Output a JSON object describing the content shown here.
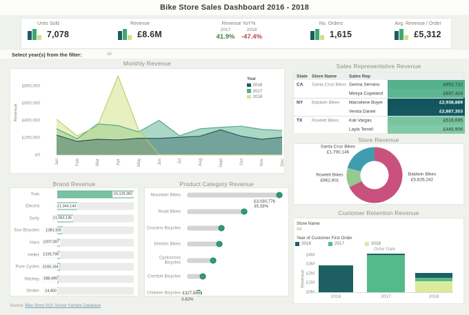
{
  "header": {
    "title": "Bike Store Sales Dashboard 2016 - 2018"
  },
  "kpis": {
    "units_sold": {
      "label": "Units Sold",
      "value": "7,078"
    },
    "revenue": {
      "label": "Revenue",
      "value": "£8.6M"
    },
    "yoy": {
      "label": "Revenue YoY%",
      "items": [
        {
          "year": "2017",
          "value": "41.9%",
          "color": "#3c7f45"
        },
        {
          "year": "2018",
          "value": "-47.4%",
          "color": "#bf4147"
        }
      ]
    },
    "orders": {
      "label": "No. Orders",
      "value": "1,615"
    },
    "avg_revenue": {
      "label": "Avg. Revenue / Order",
      "value": "£5,312"
    }
  },
  "filter": {
    "label": "Select year(s) from the filter:",
    "value": "All"
  },
  "palette": {
    "y2016": "#1d5c61",
    "y2017": "#4fb086",
    "y2018": "#d6e494",
    "kpi_bar_2016": "#1d5c61",
    "kpi_bar_2017": "#3fa86e",
    "kpi_bar_2018": "#cde08e"
  },
  "source": {
    "prefix": "Source: ",
    "link": "Bike Store SQL Server Sample Database"
  },
  "chart_data": [
    {
      "id": "monthly_revenue",
      "type": "area",
      "title": "Monthly Revenue",
      "xlabel": "",
      "ylabel": "Revenue",
      "x": [
        "Jan",
        "Feb",
        "Mar",
        "Apr",
        "May",
        "Jun",
        "Jul",
        "Aug",
        "Sept",
        "Oct",
        "Nov",
        "Dec"
      ],
      "yticks": [
        {
          "value": 0,
          "label": "£0"
        },
        {
          "value": 200000,
          "label": "£200,000"
        },
        {
          "value": 400000,
          "label": "£400,000"
        },
        {
          "value": 600000,
          "label": "£600,000"
        },
        {
          "value": 800000,
          "label": "£800,000"
        }
      ],
      "ylim": [
        0,
        1000000
      ],
      "legend_title": "Year",
      "legend_position": "top-right",
      "grid": false,
      "series": [
        {
          "name": "2016",
          "color": "#1e4f56",
          "fill": "rgba(35,85,92,0.40)",
          "values": [
            233000,
            160000,
            184000,
            177000,
            196000,
            194000,
            208000,
            221000,
            295000,
            221000,
            184000,
            208000
          ]
        },
        {
          "name": "2017",
          "color": "#4aa385",
          "fill": "rgba(85,178,140,0.50)",
          "values": [
            307000,
            191000,
            364000,
            344000,
            270000,
            406000,
            226000,
            307000,
            324000,
            337000,
            300000,
            287000
          ]
        },
        {
          "name": "2018",
          "color": "#b4cd6b",
          "fill": "rgba(209,226,132,0.50)",
          "values": [
            417000,
            224000,
            339000,
            922000,
            295000,
            6000,
            4000,
            4000,
            4000,
            4000,
            4000,
            4000
          ]
        }
      ]
    },
    {
      "id": "sales_rep_revenue",
      "type": "table",
      "title": "Sales Representative Revenue",
      "columns": [
        "State",
        "Store Name",
        "Sales Rep"
      ],
      "rows": [
        {
          "state": "CA",
          "store": "Santa Cruz Bikes",
          "rep": "Genna Serrano",
          "value": "£952,722",
          "cell_bg": "#55b18b",
          "cell_text": "#2d2d2d",
          "bold": false
        },
        {
          "state": "",
          "store": "",
          "rep": "Mireya Copeland",
          "value": "£837,424",
          "cell_bg": "#5eb692",
          "cell_text": "#2d2d2d",
          "bold": false
        },
        {
          "state": "NY",
          "store": "Baldwin Bikes",
          "rep": "Marcelene Boyer",
          "value": "£2,938,889",
          "cell_bg": "#11565e",
          "cell_text": "#ffffff",
          "bold": true
        },
        {
          "state": "",
          "store": "",
          "rep": "Venita Daniel",
          "value": "£2,887,353",
          "cell_bg": "#13585f",
          "cell_text": "#ffffff",
          "bold": true
        },
        {
          "state": "TX",
          "store": "Rowlett Bikes",
          "rep": "Kali Vargas",
          "value": "£516,695",
          "cell_bg": "#78c49f",
          "cell_text": "#2d2d2d",
          "bold": false
        },
        {
          "state": "",
          "store": "",
          "rep": "Layla Terrell",
          "value": "£445,906",
          "cell_bg": "#82c9a6",
          "cell_text": "#2d2d2d",
          "bold": false
        }
      ]
    },
    {
      "id": "store_revenue",
      "type": "pie",
      "title": "Store Revenue",
      "donut": true,
      "slices": [
        {
          "label": "Baldwin Bikes",
          "value": 5826242,
          "value_label": "£5,826,242",
          "color": "#c9517e"
        },
        {
          "label": "Rowlett Bikes",
          "value": 962601,
          "value_label": "£962,601",
          "color": "#94ca92"
        },
        {
          "label": "Santa Cruz Bikes",
          "value": 1790146,
          "value_label": "£1,790,146",
          "color": "#3e9dae"
        }
      ]
    },
    {
      "id": "brand_revenue",
      "type": "bar",
      "title": "Brand Revenue",
      "orientation": "horizontal",
      "categories": [
        "Trek",
        "Electra",
        "Surly",
        "Sun Bicycles",
        "Haro",
        "Heller",
        "Pure Cycles",
        "Ritchey",
        "Strider"
      ],
      "values": [
        5129382,
        1344144,
        1063136,
        381920,
        207097,
        193799,
        166164,
        88499,
        4850
      ],
      "value_labels": [
        "£5,129,382",
        "£1,344,144",
        "£1,063,136",
        "£381,920",
        "£207,097",
        "£193,799",
        "£166,164",
        "£88,499",
        "£4,850"
      ],
      "xlim": [
        0,
        5129382
      ]
    },
    {
      "id": "product_category_revenue",
      "type": "bar",
      "title": "Product Category Revenue",
      "orientation": "horizontal",
      "style": "lollipop",
      "categories": [
        "Mountain Bikes",
        "Road Bikes",
        "Cruisers Bicycles",
        "Electric Bikes",
        "Cyclocross Bicycles",
        "Comfort Bicycles",
        "Children Bicycles"
      ],
      "fraction_of_max": [
        1.0,
        0.62,
        0.375,
        0.35,
        0.285,
        0.175,
        0.13
      ],
      "annotations": [
        {
          "category": "Mountain Bikes",
          "value_label": "£3,030,776",
          "pct_label": "35.33%",
          "placement": "below-end"
        },
        {
          "category": "Children Bicycles",
          "value_label": "£327,888",
          "pct_label": "3.82%",
          "placement": "left-overlap"
        }
      ]
    },
    {
      "id": "customer_retention_revenue",
      "type": "bar",
      "title": "Customer Retention Revenue",
      "stacked": true,
      "filters": [
        {
          "label": "Store Name",
          "value": "All"
        }
      ],
      "legend_title": "Year of Customer First Order",
      "legend": [
        {
          "name": "2016",
          "color": "#1d5f63"
        },
        {
          "name": "2017",
          "color": "#54b98b"
        },
        {
          "name": "2018",
          "color": "#dcea9b"
        }
      ],
      "xlabel": "Order Date",
      "ylabel": "Revenue",
      "categories": [
        "2016",
        "2017",
        "2018"
      ],
      "yticks": [
        {
          "value": 0,
          "label": "£0M"
        },
        {
          "value": 1,
          "label": "£1M"
        },
        {
          "value": 2,
          "label": "£2M"
        },
        {
          "value": 3,
          "label": "£3M"
        },
        {
          "value": 4,
          "label": "£4M"
        }
      ],
      "ylim": [
        0,
        4.3
      ],
      "bars": [
        {
          "category": "2016",
          "segments": [
            {
              "cohort": "2016",
              "value": 2.89,
              "color": "#1d5f63"
            }
          ]
        },
        {
          "category": "2017",
          "segments": [
            {
              "cohort": "2017",
              "value": 3.97,
              "color": "#54b98b"
            },
            {
              "cohort": "2016",
              "value": 0.14,
              "color": "#1d5f63"
            }
          ]
        },
        {
          "category": "2018",
          "segments": [
            {
              "cohort": "2018",
              "value": 1.16,
              "color": "#dcea9b"
            },
            {
              "cohort": "2017",
              "value": 0.41,
              "color": "#54b98b"
            },
            {
              "cohort": "2016",
              "value": 0.51,
              "color": "#1d5f63"
            }
          ]
        }
      ]
    }
  ]
}
